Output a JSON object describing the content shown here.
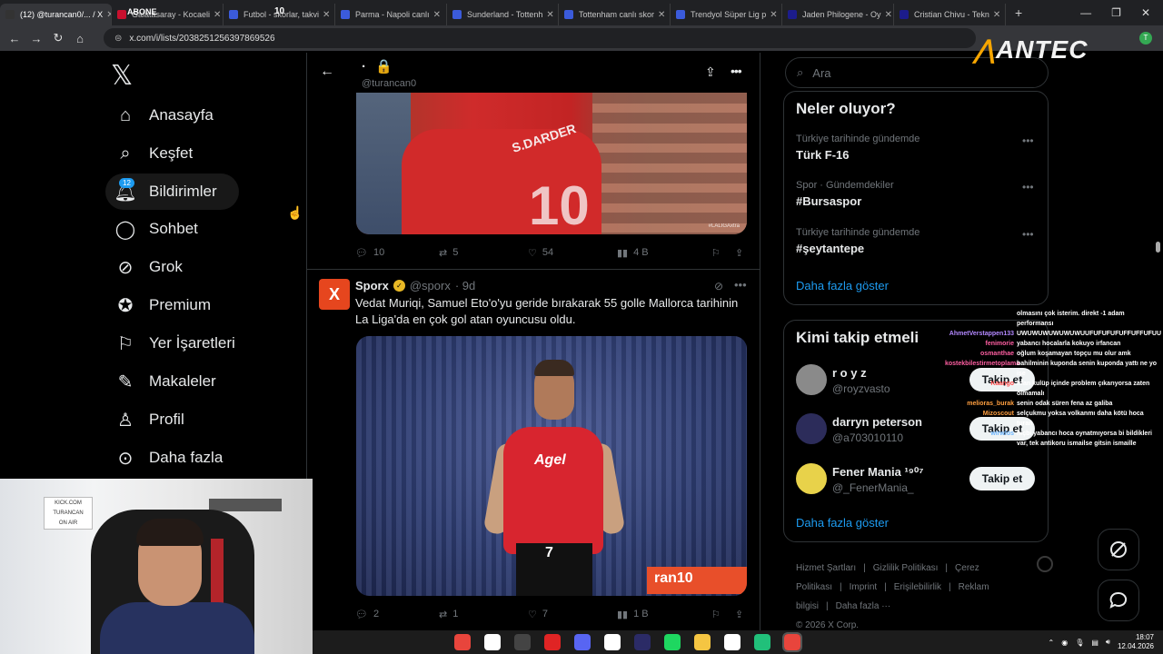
{
  "browser": {
    "tabs": [
      {
        "label": "(12) @turancan0/... / X",
        "color": "#333333",
        "active": true
      },
      {
        "label": "Galatasaray - Kocaeli",
        "color": "#c8102e"
      },
      {
        "label": "Futbol - skorlar, takvi",
        "color": "#3b5bdb"
      },
      {
        "label": "Parma - Napoli canlı",
        "color": "#3b5bdb"
      },
      {
        "label": "Sunderland - Tottenh",
        "color": "#3b5bdb"
      },
      {
        "label": "Tottenham canlı skor",
        "color": "#3b5bdb"
      },
      {
        "label": "Trendyol Süper Lig p",
        "color": "#3b5bdb"
      },
      {
        "label": "Jaden Philogene - Oy",
        "color": "#1c1c8c"
      },
      {
        "label": "Cristian Chivu - Tekn",
        "color": "#1c1c8c"
      }
    ],
    "tab_overlay_left": "ABONE",
    "tab_overlay_right": "10",
    "url": "x.com/i/lists/2038251256397869526",
    "profile_initial": "T"
  },
  "sidebar": {
    "items": [
      {
        "label": "Anasayfa",
        "icon": "home-icon"
      },
      {
        "label": "Keşfet",
        "icon": "search-icon"
      },
      {
        "label": "Bildirimler",
        "icon": "bell-icon"
      },
      {
        "label": "Sohbet",
        "icon": "chat-icon"
      },
      {
        "label": "Grok",
        "icon": "grok-icon"
      },
      {
        "label": "Premium",
        "icon": "verified-icon"
      },
      {
        "label": "Yer İşaretleri",
        "icon": "bookmark-icon"
      },
      {
        "label": "Makaleler",
        "icon": "article-icon"
      },
      {
        "label": "Profil",
        "icon": "person-icon"
      },
      {
        "label": "Daha fazla",
        "icon": "more-circle-icon"
      }
    ],
    "notification_count": "12"
  },
  "header": {
    "name": "·",
    "handle": "@turancan0"
  },
  "tweet1": {
    "media_text": "S.DARDER",
    "media_number": "10",
    "watermark": "#LALIGAxtra",
    "replies": "10",
    "retweets": "5",
    "likes": "54",
    "views": "4 B"
  },
  "tweet2": {
    "avatar": "X",
    "author": "Sporx",
    "handle": "@sporx",
    "date": "· 9d",
    "text": "Vedat Muriqi, Samuel Eto'o'yu geride bırakarak 55 golle Mallorca tarihinin La Liga'da en çok gol atan oyuncusu oldu.",
    "media_sponsor": "Αgel",
    "media_ad": "ran10",
    "media_number": "7",
    "replies": "2",
    "retweets": "1",
    "likes": "7",
    "views": "1 B"
  },
  "search": {
    "placeholder": "Ara"
  },
  "overlay_logo": "ANTEC",
  "trends": {
    "title": "Neler oluyor?",
    "items": [
      {
        "context": "Türkiye tarihinde gündemde",
        "name": "Türk F-16"
      },
      {
        "context": "Spor · Gündemdekiler",
        "name": "#Bursaspor"
      },
      {
        "context": "Türkiye tarihinde gündemde",
        "name": "#şeytantepe"
      }
    ],
    "show_more": "Daha fazla göster"
  },
  "who_to_follow": {
    "title": "Kimi takip etmeli",
    "users": [
      {
        "name": "r o y z",
        "handle": "@royzvasto",
        "avatar_color": "#8a8a8a"
      },
      {
        "name": "darryn peterson",
        "handle": "@a703010110",
        "avatar_color": "#2c2c5a"
      },
      {
        "name": "Fener Mania ¹⁹⁰⁷",
        "handle": "@_FenerMania_",
        "avatar_color": "#e8d24a"
      }
    ],
    "follow_label": "Takip et",
    "show_more": "Daha fazla göster"
  },
  "footer": {
    "links": [
      "Hizmet Şartları",
      "|",
      "Gizlilik Politikası",
      "|",
      "Çerez Politikası",
      "|",
      "Imprint",
      "|",
      "Erişilebilirlik",
      "|",
      "Reklam bilgisi",
      "|",
      "Daha fazla ···"
    ],
    "copyright": "© 2026 X Corp."
  },
  "chat": [
    {
      "user": "",
      "msg": "olmasını çok isterim. direkt -1 adam performansı",
      "color": "#ffffff"
    },
    {
      "user": "AhmetVerstappen133",
      "msg": "UWUWUWUWUWUWUUFUFUFUFUFFUFFUFUU",
      "color": "#b388ff"
    },
    {
      "user": "fenimorie",
      "msg": "yabancı hocalarla kokuyo irfancan",
      "color": "#ff5fa2"
    },
    {
      "user": "osmanthae",
      "msg": "oğlum koşamayan topçu mu olur amk",
      "color": "#ff5fa2"
    },
    {
      "user": "kostekbilestirmetoplama",
      "msg": "bahilminin kuponda senin kuponda yattı ne yo işe",
      "color": "#ff5fa2"
    },
    {
      "user": "Kaango",
      "msg": "İrfan kulüp içinde problem çıkarıyorsa zaten olmamalı",
      "color": "#ff4d4d"
    },
    {
      "user": "melioras_burak",
      "msg": "senin odak süren fena az galiba",
      "color": "#ff9f40"
    },
    {
      "user": "Mizoscout",
      "msg": "selçukmu yoksa volkanmı daha kötü hoca turan",
      "color": "#ff9f40"
    },
    {
      "user": "wirwlos",
      "msg": "hiçbi yabancı hoca oynatmıyorsa bi bildikleri var, tek antikoru ismailse gitsin ismaille",
      "color": "#6fb7ff"
    }
  ],
  "webcam_sign": [
    "KICK.COM",
    "TURANCAN",
    "ON AIR"
  ],
  "taskbar": {
    "icons": [
      {
        "name": "chrome-taskbar-icon",
        "color": "#e8453c"
      },
      {
        "name": "capcut-taskbar-icon",
        "color": "#ffffff"
      },
      {
        "name": "obs-taskbar-icon",
        "color": "#444444"
      },
      {
        "name": "record-taskbar-icon",
        "color": "#e02424"
      },
      {
        "name": "discord-taskbar-icon",
        "color": "#5865f2"
      },
      {
        "name": "capcut2-taskbar-icon",
        "color": "#ffffff"
      },
      {
        "name": "premiere-taskbar-icon",
        "color": "#2b2b66"
      },
      {
        "name": "spotify-taskbar-icon",
        "color": "#1ed760"
      },
      {
        "name": "folder-taskbar-icon",
        "color": "#f5c542"
      },
      {
        "name": "capcut3-taskbar-icon",
        "color": "#ffffff"
      },
      {
        "name": "app-green-taskbar-icon",
        "color": "#21c07a"
      },
      {
        "name": "chrome2-taskbar-icon",
        "color": "#e8453c"
      }
    ],
    "time": "18:07",
    "date": "12.04.2026"
  },
  "colors": {
    "accent": "#1d9bf0",
    "background": "#000000",
    "muted": "#71767b"
  }
}
